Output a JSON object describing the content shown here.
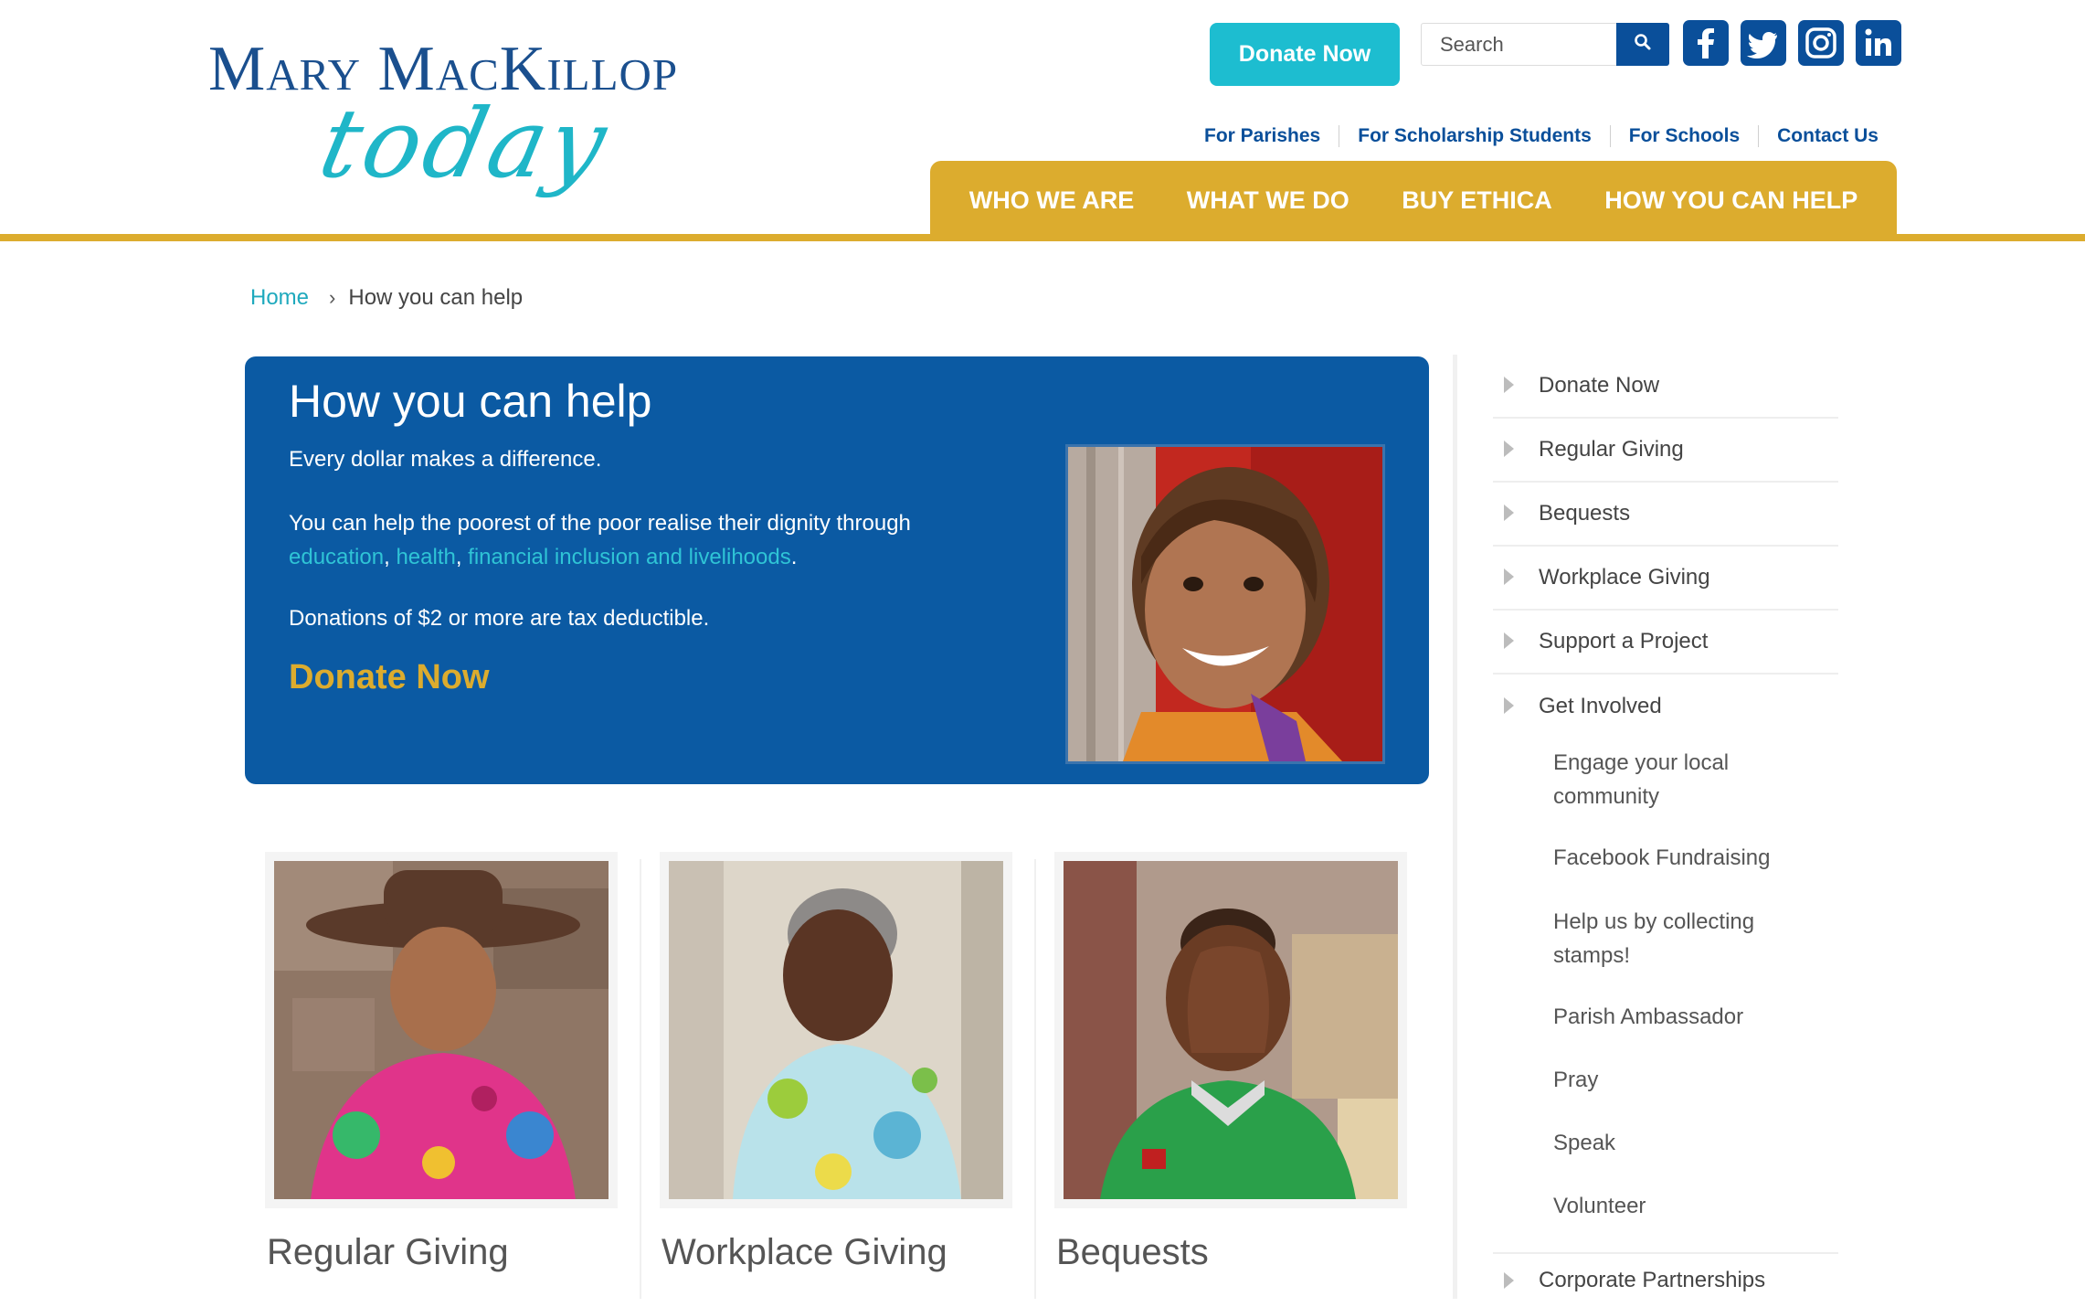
{
  "header": {
    "logo_top": "Mary MacKillop",
    "logo_script": "today",
    "donate_button": "Donate Now",
    "search_placeholder": "Search",
    "social": [
      "facebook-icon",
      "twitter-icon",
      "instagram-icon",
      "linkedin-icon"
    ],
    "utility_nav": [
      "For Parishes",
      "For Scholarship Students",
      "For Schools",
      "Contact Us"
    ],
    "main_nav": [
      "WHO WE ARE",
      "WHAT WE DO",
      "BUY ETHICA",
      "HOW YOU CAN HELP"
    ]
  },
  "breadcrumb": {
    "home": "Home",
    "separator": "›",
    "current": "How you can help"
  },
  "hero": {
    "title": "How you can help",
    "line1": "Every dollar makes a difference.",
    "line2_prefix": "You can help the poorest of the poor realise their dignity through",
    "link_education": "education",
    "comma1": ", ",
    "link_health": "health",
    "comma2": ", ",
    "link_financial": "financial inclusion and livelihoods",
    "period": ".",
    "line3": "Donations of $2 or more are tax deductible.",
    "donate_link": "Donate Now"
  },
  "cards": [
    {
      "title": "Regular Giving"
    },
    {
      "title": "Workplace Giving"
    },
    {
      "title": "Bequests"
    }
  ],
  "sidebar": {
    "items": [
      "Donate Now",
      "Regular Giving",
      "Bequests",
      "Workplace Giving",
      "Support a Project",
      "Get Involved"
    ],
    "sub_items": [
      "Engage your local community",
      "Facebook Fundraising",
      "Help us by collecting stamps!",
      "Parish Ambassador",
      "Pray",
      "Speak",
      "Volunteer"
    ],
    "last_item": "Corporate Partnerships"
  },
  "colors": {
    "brand_blue": "#0b5aa3",
    "accent_gold": "#dcac2e",
    "teal": "#1dbdd0"
  }
}
